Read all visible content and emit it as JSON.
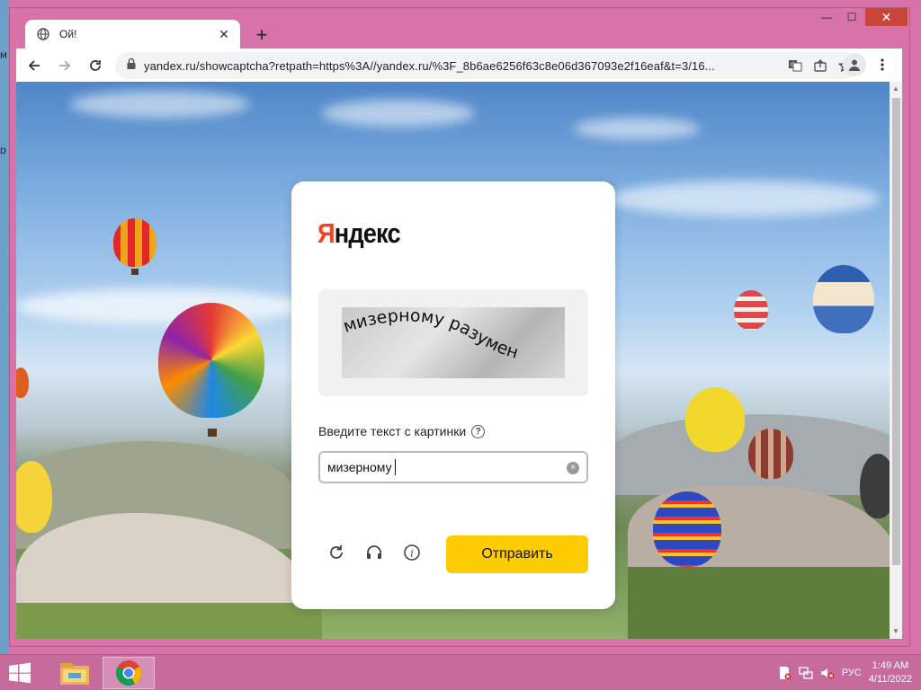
{
  "desktop": {
    "edge_letters": [
      "M",
      "D"
    ]
  },
  "browser": {
    "tab": {
      "title": "Ой!",
      "favicon": "globe-icon"
    },
    "new_tab_label": "+",
    "window_controls": {
      "minimize": "—",
      "maximize": "☐",
      "close": "✕"
    },
    "nav": {
      "back": "arrow-left-icon",
      "forward": "arrow-right-icon",
      "reload": "reload-icon"
    },
    "address": {
      "url": "yandex.ru/showcaptcha?retpath=https%3A//yandex.ru/%3F_8b6ae6256f63c8e06d367093e2f16eaf&t=3/16...",
      "lock_icon": "lock-icon"
    },
    "omnibox_icons": [
      "translate-icon",
      "share-icon",
      "star-icon"
    ],
    "toolbar_icons": [
      "profile-icon",
      "kebab-menu-icon"
    ]
  },
  "captcha_page": {
    "logo": {
      "first_letter": "Я",
      "rest": "ндекс"
    },
    "captcha_text": "мизерному разумен",
    "prompt_label": "Введите текст с картинки",
    "help_icon": "?",
    "input": {
      "value": "мизерному"
    },
    "clear_icon": "×",
    "actions": [
      "refresh-icon",
      "audio-icon",
      "info-icon"
    ],
    "submit_label": "Отправить",
    "colors": {
      "accent": "#ffcc00",
      "logo_red": "#fc3f1d"
    }
  },
  "taskbar": {
    "apps": [
      "windows-start-icon",
      "file-explorer-icon",
      "chrome-icon"
    ],
    "language": "РУС",
    "time": "1:49 AM",
    "date": "4/11/2022"
  }
}
